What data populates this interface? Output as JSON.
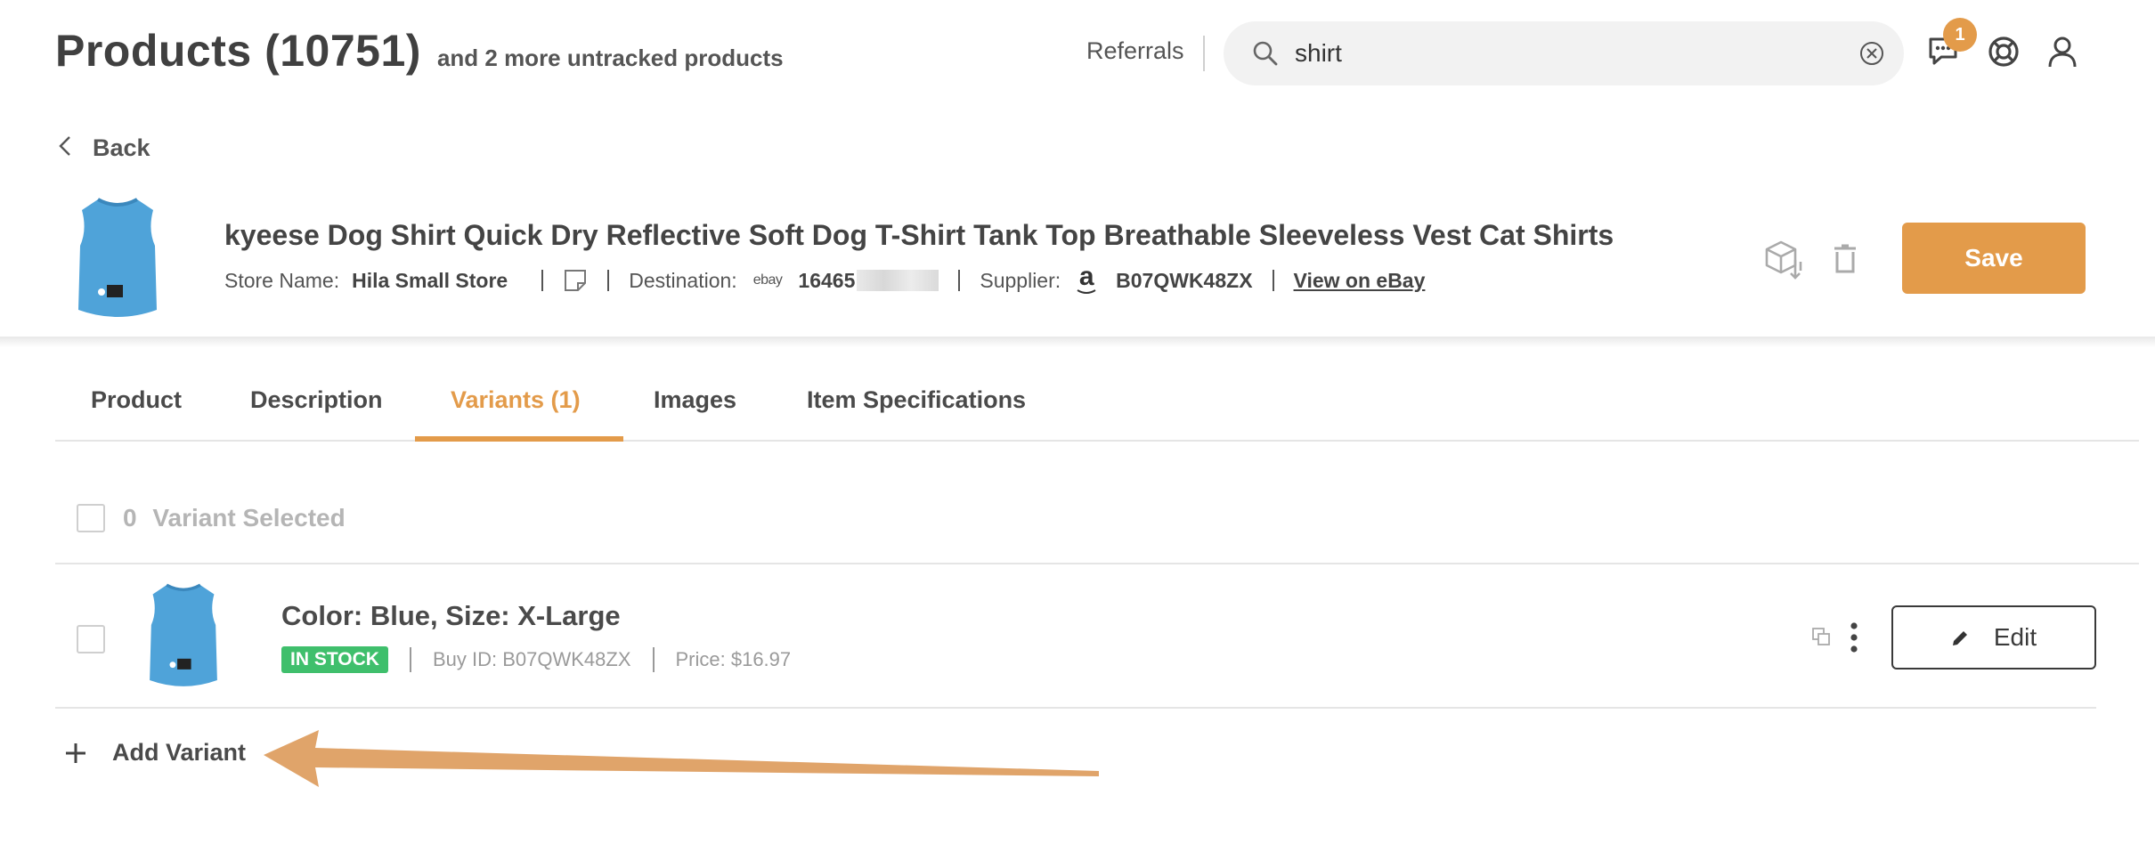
{
  "header": {
    "title": "Products (10751)",
    "subtitle": "and 2 more untracked products",
    "referrals_label": "Referrals",
    "search": {
      "value": "shirt",
      "placeholder": ""
    },
    "notification_count": "1"
  },
  "product": {
    "back_label": "Back",
    "name": "kyeese Dog Shirt Quick Dry Reflective Soft Dog T-Shirt Tank Top Breathable Sleeveless Vest Cat Shirts",
    "store_label": "Store Name:",
    "store_name": "Hila Small Store",
    "destination_label": "Destination:",
    "destination_logo": "ebay",
    "destination_id": "16465",
    "supplier_label": "Supplier:",
    "supplier_logo": "a",
    "supplier_id": "B07QWK48ZX",
    "view_link": "View on eBay",
    "save_label": "Save"
  },
  "tabs": [
    {
      "label": "Product"
    },
    {
      "label": "Description"
    },
    {
      "label": "Variants (1)",
      "active": true
    },
    {
      "label": "Images"
    },
    {
      "label": "Item Specifications"
    }
  ],
  "variants": {
    "selected_count": "0",
    "selected_label": "Variant Selected",
    "items": [
      {
        "title": "Color: Blue, Size: X-Large",
        "stock": "IN STOCK",
        "buy_id": "Buy ID: B07QWK48ZX",
        "price": "Price: $16.97",
        "edit_label": "Edit"
      }
    ],
    "add_label": "Add Variant"
  },
  "colors": {
    "accent": "#e39b4a",
    "in_stock": "#3fbf6c",
    "shirt": "#4fa3d9"
  }
}
